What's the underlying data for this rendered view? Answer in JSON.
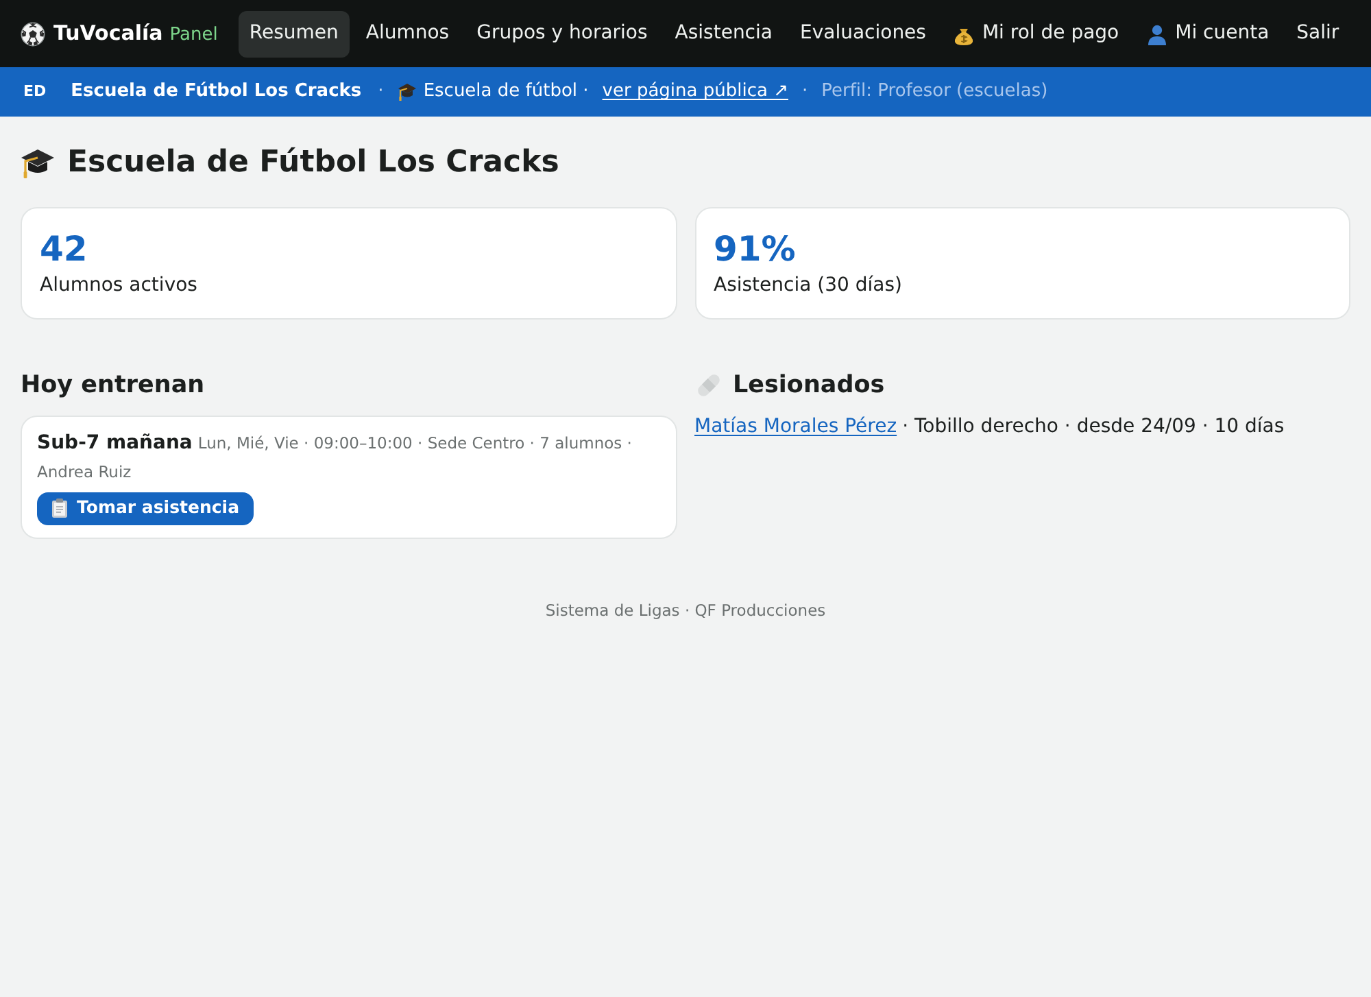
{
  "nav": {
    "brand": "TuVocalía",
    "brand_tag": "Panel",
    "items": [
      {
        "label": "Resumen",
        "kind": "plain",
        "selected": true
      },
      {
        "label": "Alumnos",
        "kind": "plain",
        "selected": false
      },
      {
        "label": "Grupos y horarios",
        "kind": "plain",
        "selected": false
      },
      {
        "label": "Asistencia",
        "kind": "plain",
        "selected": false
      },
      {
        "label": "Evaluaciones",
        "kind": "plain",
        "selected": false
      },
      {
        "label": "Mi rol de pago",
        "kind": "money",
        "selected": false
      },
      {
        "label": "Mi cuenta",
        "kind": "account",
        "selected": false
      },
      {
        "label": "Salir",
        "kind": "plain",
        "selected": false
      }
    ]
  },
  "context_bar": {
    "badge": "ED",
    "org_name": "Escuela de Fútbol Los Cracks",
    "items": [
      {
        "kind": "separator",
        "text": "·"
      },
      {
        "kind": "category",
        "text": "Escuela de fútbol ·"
      },
      {
        "kind": "link",
        "text": "ver página pública ↗"
      },
      {
        "kind": "separator",
        "text": "·"
      },
      {
        "kind": "muted",
        "text": "Perfil: Profesor (escuelas)"
      }
    ]
  },
  "page_title": "Escuela de Fútbol Los Cracks",
  "stats": [
    {
      "value": "42",
      "label": "Alumnos activos"
    },
    {
      "value": "91%",
      "label": "Asistencia (30 días)"
    }
  ],
  "today_training": {
    "title": "Hoy entrenan",
    "groups": [
      {
        "name": "Sub-7 mañana",
        "details": "Lun, Mié, Vie · 09:00–10:00 · Sede Centro · 7 alumnos · Andrea Ruiz",
        "action": "Tomar asistencia"
      }
    ]
  },
  "injured": {
    "title": "Lesionados",
    "entries": [
      {
        "player": "Matías Morales Pérez",
        "details": "· Tobillo derecho · desde 24/09 · 10 días"
      }
    ]
  },
  "footer": "Sistema de Ligas · QF Producciones"
}
